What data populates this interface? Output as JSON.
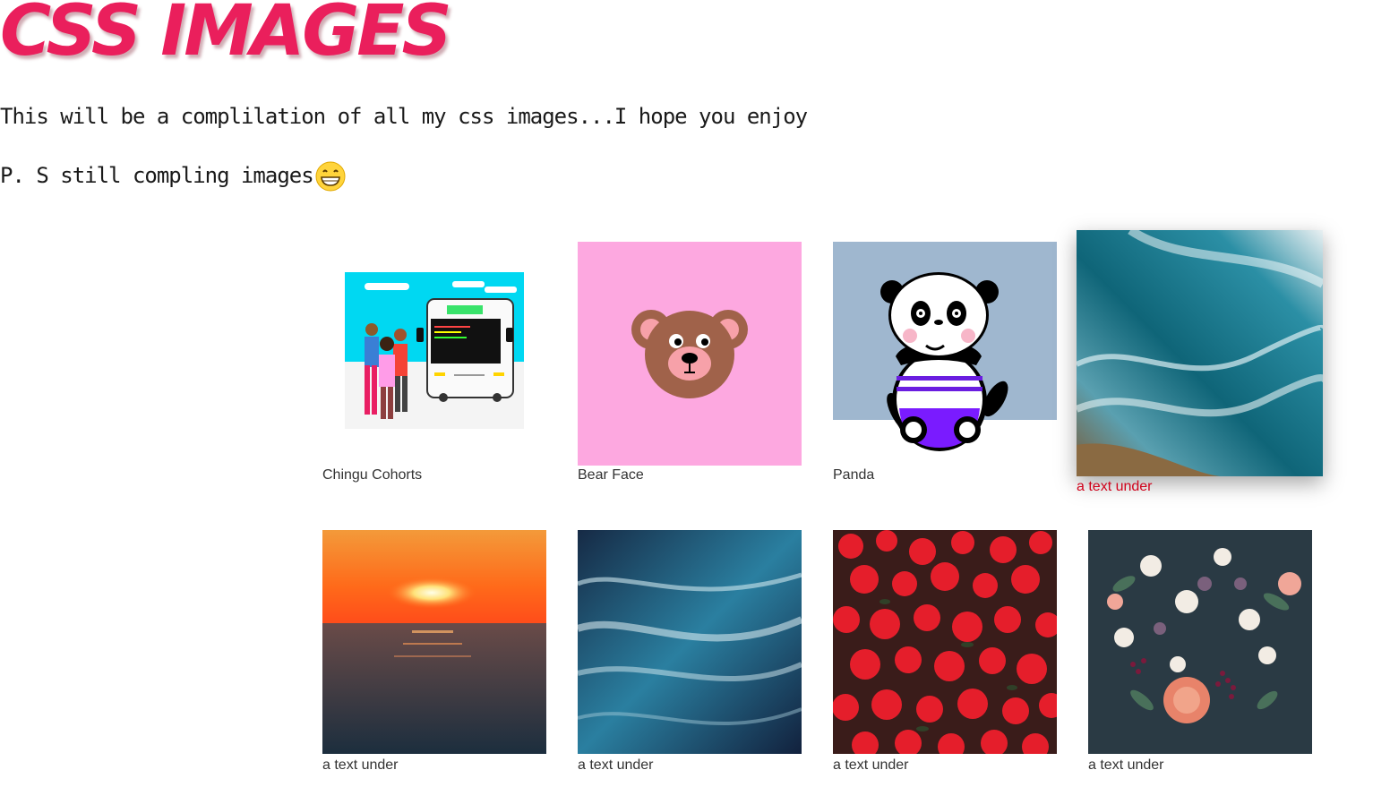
{
  "header": {
    "title": "CSS IMAGES",
    "intro": "This will be a complilation of all my css images...I hope you enjoy",
    "note": "P. S still compling images",
    "note_emoji": "grinning-face-icon"
  },
  "gallery": {
    "row1": [
      {
        "caption": "Chingu Cohorts",
        "image": "chingu-cohorts-illustration"
      },
      {
        "caption": "Bear Face",
        "image": "bear-face-illustration"
      },
      {
        "caption": "Panda",
        "image": "panda-illustration"
      },
      {
        "caption": "a text under",
        "image": "ocean-wave-photo"
      }
    ],
    "row2": [
      {
        "caption": "a text under",
        "image": "sunset-sea-photo"
      },
      {
        "caption": "a text under",
        "image": "ocean-water-photo"
      },
      {
        "caption": "a text under",
        "image": "red-flowers-photo"
      },
      {
        "caption": "a text under",
        "image": "flower-bouquet-photo"
      }
    ]
  },
  "colors": {
    "title": "#ea1f5c",
    "hover_caption": "#d0021b",
    "bear_bg": "#fda8e0",
    "panda_bg": "#9fb7cf"
  }
}
